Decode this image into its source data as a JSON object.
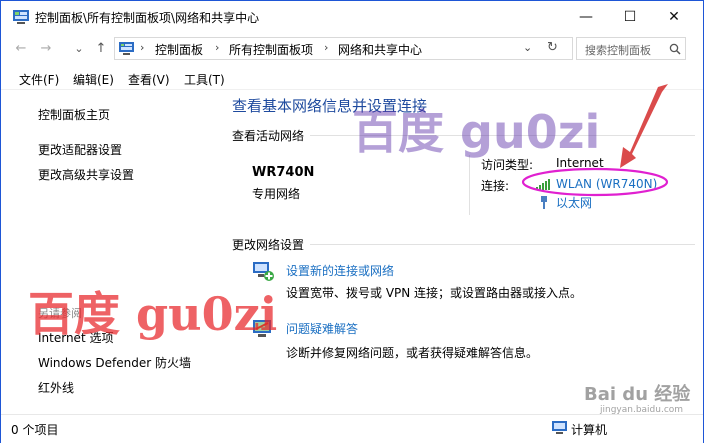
{
  "window": {
    "title": "控制面板\\所有控制面板项\\网络和共享中心",
    "minimize_glyph": "—",
    "maximize_glyph": "☐",
    "close_glyph": "✕"
  },
  "nav": {
    "back_glyph": "←",
    "forward_glyph": "→",
    "recent_glyph": "⌄",
    "up_glyph": "↑"
  },
  "address": {
    "crumbs": [
      "控制面板",
      "所有控制面板项",
      "网络和共享中心"
    ],
    "separator": "›",
    "dropdown_glyph": "⌄",
    "refresh_glyph": "↻"
  },
  "search": {
    "placeholder": "搜索控制面板"
  },
  "menu": [
    "文件(F)",
    "编辑(E)",
    "查看(V)",
    "工具(T)"
  ],
  "sidebar": {
    "links": [
      "控制面板主页",
      "更改适配器设置",
      "更改高级共享设置"
    ],
    "see_also_label": "另请参阅",
    "see_also": [
      "Internet 选项",
      "Windows Defender 防火墙",
      "红外线"
    ]
  },
  "main": {
    "heading": "查看基本网络信息并设置连接",
    "active_label": "查看活动网络",
    "network_name": "WR740N",
    "network_type": "专用网络",
    "access_type_label": "访问类型:",
    "access_type_value": "Internet",
    "connections_label": "连接:",
    "connections": [
      "WLAN (WR740N)",
      "以太网"
    ],
    "change_label": "更改网络设置",
    "tasks": [
      {
        "title": "设置新的连接或网络",
        "desc": "设置宽带、拨号或 VPN 连接；或设置路由器或接入点。"
      },
      {
        "title": "问题疑难解答",
        "desc": "诊断并修复网络问题，或者获得疑难解答信息。"
      }
    ]
  },
  "status": {
    "left": "0 个项目",
    "right": "计算机"
  },
  "watermarks": {
    "top": "百度 gu0zi",
    "left": "百度 gu0zi",
    "baidu_logo": "Bai du 经验",
    "baidu_url": "jingyan.baidu.com"
  },
  "colors": {
    "link": "#1a6fc2",
    "heading": "#1e4a9e",
    "annotation": "#e020d0",
    "arrow": "#d42b2b"
  }
}
